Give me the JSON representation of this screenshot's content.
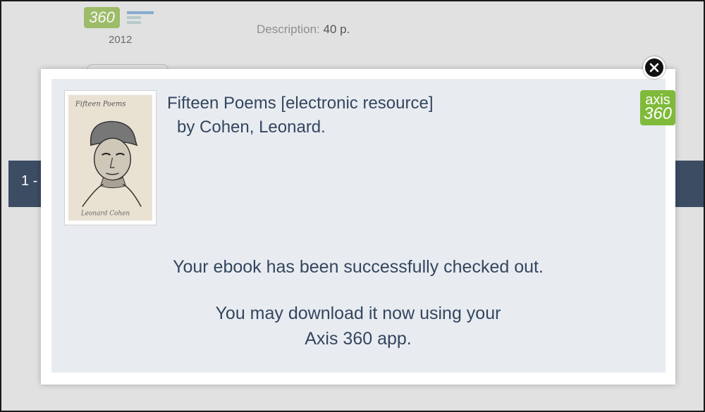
{
  "background": {
    "badge_text": "360",
    "year": "2012",
    "description_label": "Description:",
    "description_value": "40 p.",
    "range_text": "1 -"
  },
  "modal": {
    "title": "Fifteen Poems [electronic resource]",
    "author": "by Cohen, Leonard.",
    "badge_top": "axis",
    "badge_bottom": "360",
    "message_line1": "Your ebook has been successfully checked out.",
    "message_line2": "You may download it now using your",
    "message_line3": "Axis 360 app.",
    "cover_icon": "book-cover-portrait",
    "close_icon": "close-icon"
  },
  "colors": {
    "text": "#34465e",
    "band": "#3b4c63",
    "axis_green": "#7fba3a",
    "modal_inner": "#e8ecf1"
  }
}
